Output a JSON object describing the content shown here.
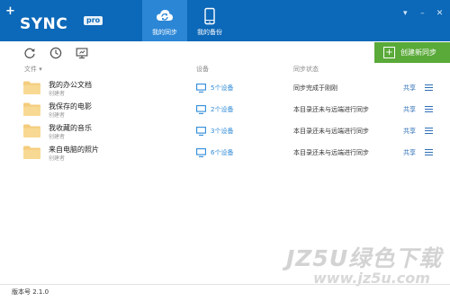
{
  "app": {
    "logo_plus": "+",
    "logo_text": "SYNC",
    "logo_badge": "pro",
    "brand_color": "#0c68b8",
    "accent_green": "#5aaa39"
  },
  "tabs": [
    {
      "label": "我的同步",
      "icon": "cloud-sync-icon",
      "active": true
    },
    {
      "label": "我的备份",
      "icon": "phone-icon",
      "active": false
    }
  ],
  "window_controls": {
    "menu": "▾",
    "minimize": "–",
    "close": "✕"
  },
  "toolbar": {
    "icons": [
      "refresh-icon",
      "clock-icon",
      "monitor-icon"
    ],
    "new_sync_icon": "+",
    "new_sync_label": "创建新同步"
  },
  "columns": {
    "file": "文件 ▾",
    "device": "设备",
    "status": "同步状态"
  },
  "rows": [
    {
      "name": "我的办公文档",
      "owner": "创建者",
      "devices": "5个设备",
      "status": "同步完成于刚刚",
      "share": "共享"
    },
    {
      "name": "我保存的电影",
      "owner": "创建者",
      "devices": "2个设备",
      "status": "本目录还未与远端进行同步",
      "share": "共享"
    },
    {
      "name": "我收藏的音乐",
      "owner": "创建者",
      "devices": "3个设备",
      "status": "本目录还未与远端进行同步",
      "share": "共享"
    },
    {
      "name": "来自电脑的照片",
      "owner": "创建者",
      "devices": "6个设备",
      "status": "本目录还未与远端进行同步",
      "share": "共享"
    }
  ],
  "footer": {
    "version": "版本号 2.1.0"
  },
  "watermark": {
    "big": "JZ5U绿色下载",
    "url": "www.jz5u.com"
  }
}
